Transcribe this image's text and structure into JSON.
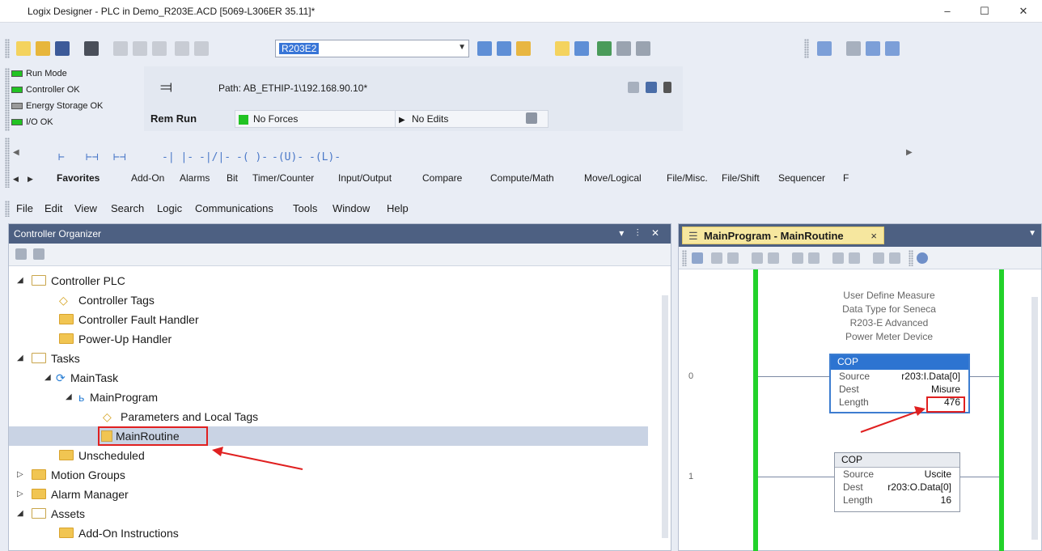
{
  "window": {
    "title": "Logix Designer - PLC in Demo_R203E.ACD [5069-L306ER 35.11]*",
    "minimize": "–",
    "maximize": "☐",
    "close": "✕"
  },
  "toolbar": {
    "routine_combo": "R203E2"
  },
  "status": {
    "indicators": [
      {
        "label": "Run Mode",
        "color": "#22c323"
      },
      {
        "label": "Controller OK",
        "color": "#22c323"
      },
      {
        "label": "Energy Storage OK",
        "color": "#9a9a9a"
      },
      {
        "label": "I/O OK",
        "color": "#22c323"
      }
    ],
    "mode": "Rem Run",
    "path": "Path: AB_ETHIP-1\\192.168.90.10*",
    "forces": "No Forces",
    "edits": "No Edits"
  },
  "instructions": {
    "symbols": [
      "⊢",
      "⊢⊣",
      "⊢⊣",
      "-| |-",
      "-|/|-",
      "-( )-",
      "-(U)-",
      "-(L)-"
    ],
    "tabs": [
      "Favorites",
      "Add-On",
      "Alarms",
      "Bit",
      "Timer/Counter",
      "Input/Output",
      "Compare",
      "Compute/Math",
      "Move/Logical",
      "File/Misc.",
      "File/Shift",
      "Sequencer",
      "F"
    ]
  },
  "menu": [
    "File",
    "Edit",
    "View",
    "Search",
    "Logic",
    "Communications",
    "Tools",
    "Window",
    "Help"
  ],
  "organizer": {
    "title": "Controller Organizer",
    "header_buttons": "▾ ⫶ ✕",
    "tree": [
      {
        "label": "Controller PLC",
        "level": 0,
        "icon": "folder-open",
        "caret": "◢"
      },
      {
        "label": "Controller Tags",
        "level": 1,
        "icon": "tag"
      },
      {
        "label": "Controller Fault Handler",
        "level": 1,
        "icon": "folder"
      },
      {
        "label": "Power-Up Handler",
        "level": 1,
        "icon": "folder"
      },
      {
        "label": "Tasks",
        "level": 0,
        "icon": "folder-open",
        "caret": "◢"
      },
      {
        "label": "MainTask",
        "level": 1,
        "icon": "task",
        "caret": "◢"
      },
      {
        "label": "MainProgram",
        "level": 2,
        "icon": "program",
        "caret": "◢"
      },
      {
        "label": "Parameters and Local Tags",
        "level": 3,
        "icon": "tag"
      },
      {
        "label": "MainRoutine",
        "level": 3,
        "icon": "routine",
        "selected": true
      },
      {
        "label": "Unscheduled",
        "level": 1,
        "icon": "folder"
      },
      {
        "label": "Motion Groups",
        "level": 0,
        "icon": "folder",
        "caret": "▷"
      },
      {
        "label": "Alarm Manager",
        "level": 0,
        "icon": "folder",
        "caret": "▷"
      },
      {
        "label": "Assets",
        "level": 0,
        "icon": "folder-open",
        "caret": "◢"
      },
      {
        "label": "Add-On Instructions",
        "level": 1,
        "icon": "folder"
      }
    ]
  },
  "routine_editor": {
    "tab": "MainProgram - MainRoutine",
    "tab_close": "×",
    "rungs": [
      {
        "number": "0",
        "comment": [
          "User Define Measure",
          "Data Type for Seneca",
          "R203-E Advanced",
          "Power Meter Device"
        ],
        "instruction": "COP",
        "rows": [
          {
            "k": "Source",
            "v": "r203:I.Data[0]"
          },
          {
            "k": "Dest",
            "v": "Misure"
          },
          {
            "k": "Length",
            "v": "476"
          }
        ]
      },
      {
        "number": "1",
        "instruction": "COP",
        "rows": [
          {
            "k": "Source",
            "v": "Uscite"
          },
          {
            "k": "Dest",
            "v": "r203:O.Data[0]"
          },
          {
            "k": "Length",
            "v": "16"
          }
        ]
      }
    ]
  },
  "accent": {
    "header": "#4d6082",
    "rail": "#22d22a",
    "selection": "#c9d3e4",
    "annotation": "#e02020"
  }
}
